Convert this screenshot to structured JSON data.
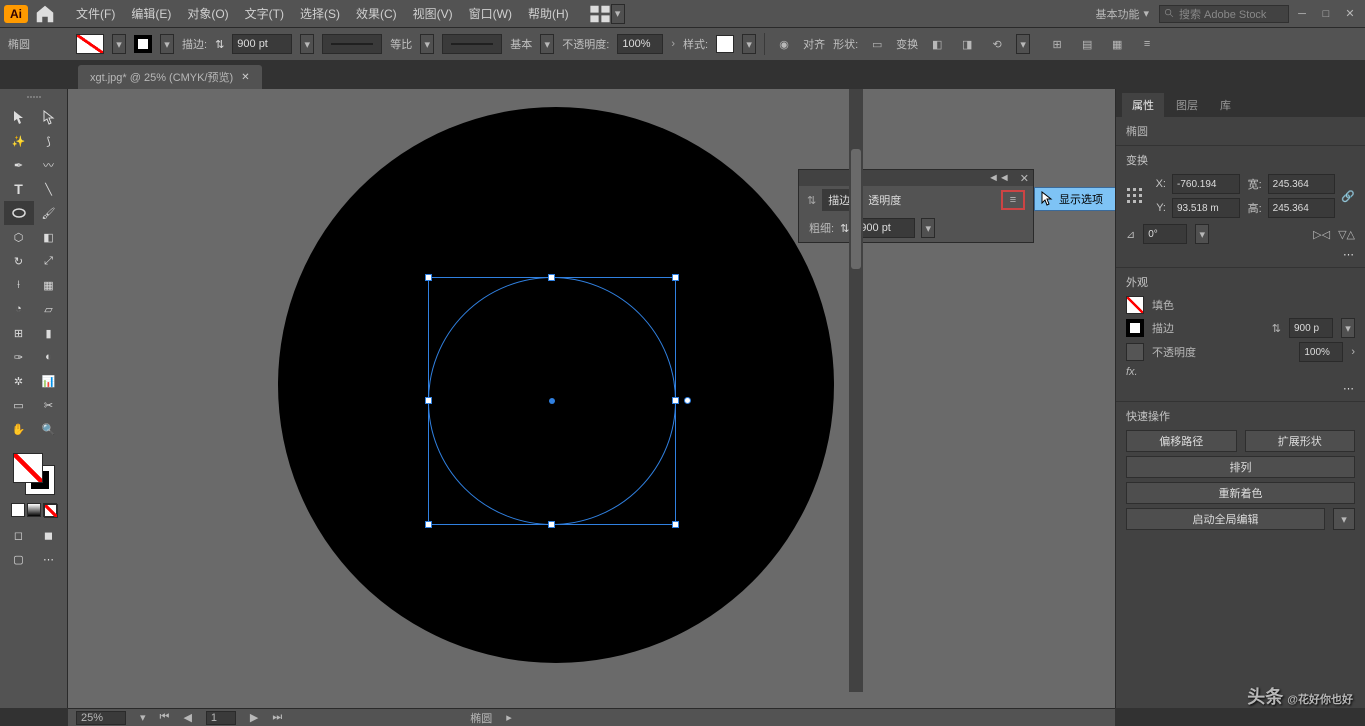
{
  "menu": {
    "items": [
      "文件(F)",
      "编辑(E)",
      "对象(O)",
      "文字(T)",
      "选择(S)",
      "效果(C)",
      "视图(V)",
      "窗口(W)",
      "帮助(H)"
    ],
    "workspace": "基本功能",
    "search_placeholder": "搜索 Adobe Stock"
  },
  "control": {
    "shape": "椭圆",
    "stroke_label": "描边:",
    "stroke_val": "900 pt",
    "profile": "等比",
    "brush": "基本",
    "opacity_label": "不透明度:",
    "opacity_val": "100%",
    "style_label": "样式:",
    "recolor": "变换",
    "align": "对齐",
    "shape_lbl": "形状:"
  },
  "doc": {
    "tab": "xgt.jpg* @ 25% (CMYK/预览)"
  },
  "stroke_panel": {
    "tab1": "描边",
    "tab2": "透明度",
    "weight_label": "粗细:",
    "weight_val": "900 pt",
    "show_options": "显示选项"
  },
  "props": {
    "tabs": [
      "属性",
      "图层",
      "库"
    ],
    "obj": "椭圆",
    "transform": "变换",
    "x": "-760.194",
    "y": "93.518 m",
    "w": "245.364",
    "h": "245.364",
    "angle": "0°",
    "appearance": "外观",
    "fill": "填色",
    "stroke": "描边",
    "stroke_val": "900 p",
    "op_label": "不透明度",
    "op_val": "100%",
    "quick": "快速操作",
    "btn_offset": "偏移路径",
    "btn_expand": "扩展形状",
    "btn_arrange": "排列",
    "btn_recolor": "重新着色",
    "btn_global": "启动全局编辑"
  },
  "status": {
    "zoom": "25%",
    "page": "1",
    "sel": "椭圆"
  },
  "watermark": {
    "lead": "头条",
    "text": "@花好你也好"
  }
}
